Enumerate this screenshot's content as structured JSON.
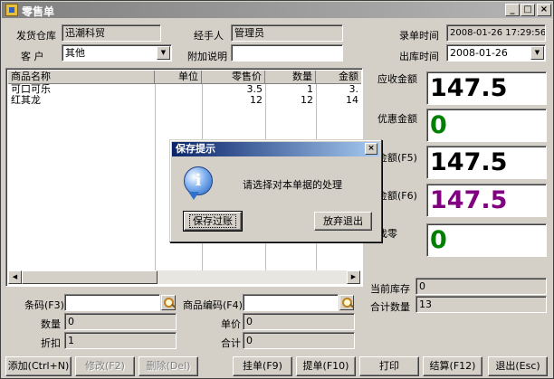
{
  "window": {
    "title": "零售单",
    "min": "_",
    "max": "□",
    "close": "×"
  },
  "header": {
    "warehouse_label": "发货仓库",
    "warehouse_value": "迅潮科贸",
    "handler_label": "经手人",
    "handler_value": "管理员",
    "entry_time_label": "录单时间",
    "entry_time_value": "2008-01-26 17:29:56",
    "customer_label": "客 户",
    "customer_value": "其他",
    "remark_label": "附加说明",
    "remark_value": "",
    "outbound_label": "出库时间",
    "outbound_value": "2008-01-26"
  },
  "grid": {
    "columns": [
      "商品名称",
      "单位",
      "零售价",
      "数量",
      "金额"
    ],
    "rows": [
      {
        "name": "可口可乐",
        "unit": "",
        "price": "3.5",
        "qty": "1",
        "amount": "3."
      },
      {
        "name": "红其龙",
        "unit": "",
        "price": "12",
        "qty": "12",
        "amount": "14"
      }
    ]
  },
  "totals": {
    "receivable_label": "应收金额",
    "receivable_value": "147.5",
    "discount_label": "优惠金额",
    "discount_value": "0",
    "cash_label": "金额(F5)",
    "cash_value": "147.5",
    "received_label": "金额(F6)",
    "received_value": "147.5",
    "change_label": "找零",
    "change_value": "0",
    "stock_label": "当前库存",
    "stock_value": "0",
    "count_label": "合计数量",
    "count_value": "13",
    "colors": {
      "receivable": "#000000",
      "discount": "#008000",
      "cash": "#000000",
      "received": "#800080",
      "change": "#008000"
    }
  },
  "entry": {
    "barcode_label": "条码(F3)",
    "barcode_value": "",
    "code_label": "商品编码(F4)",
    "code_value": "",
    "qty_label": "数量",
    "qty_value": "0",
    "price_label": "单价",
    "price_value": "0",
    "discount_label": "折扣",
    "discount_value": "1",
    "sum_label": "合计",
    "sum_value": "0"
  },
  "buttons": {
    "add": "添加(Ctrl+N)",
    "edit": "修改(F2)",
    "delete": "删除(Del)",
    "hold": "挂单(F9)",
    "retrieve": "提单(F10)",
    "print": "打印",
    "settle": "结算(F12)",
    "exit": "退出(Esc)"
  },
  "dialog": {
    "title": "保存提示",
    "close": "×",
    "message": "请选择对本单据的处理",
    "save_label": "保存过账",
    "discard_label": "放弃退出",
    "icon": "i"
  }
}
